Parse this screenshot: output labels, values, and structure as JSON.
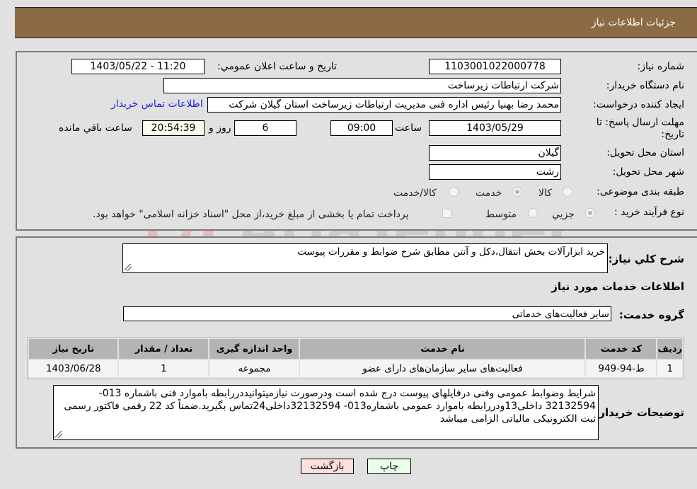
{
  "header": {
    "title": "جزئیات اطلاعات نیاز"
  },
  "form": {
    "need_number": {
      "label": "شماره نیاز:",
      "value": "1103001022000778"
    },
    "announce_datetime": {
      "label": "تاریخ و ساعت اعلان عمومي:",
      "value": "1403/05/22 - 11:20"
    },
    "buyer_org": {
      "label": "نام دستگاه خریدار:",
      "value": "شرکت ارتباطات زیرساخت"
    },
    "requester": {
      "label": "ایجاد کننده درخواست:",
      "value": "محمد رضا بهنیا رئیس اداره فنی مدیریت ارتباطات زیرساخت استان گیلان شرکت"
    },
    "buyer_contact_link": "اطلاعات تماس خریدار",
    "deadline": {
      "label": "مهلت ارسال پاسخ: تا تاریخ:",
      "date": "1403/05/29",
      "time_label": "ساعت",
      "time": "09:00",
      "days": "6",
      "days_label": "روز و",
      "remaining": "20:54:39",
      "remaining_label": "ساعت باقي مانده"
    },
    "province": {
      "label": "استان محل تحویل:",
      "value": "گیلان"
    },
    "city": {
      "label": "شهر محل تحویل:",
      "value": "رشت"
    },
    "category": {
      "label": "طبقه بندی موضوعی:",
      "options": [
        "کالا",
        "خدمت",
        "کالا/خدمت"
      ],
      "selected": "خدمت"
    },
    "purchase_type": {
      "label": "نوع فرآیند خرید :",
      "options": [
        "جزيي",
        "متوسط"
      ],
      "selected": "جزيي",
      "treasury_note": "پرداخت تمام یا بخشی از مبلغ خرید،از محل \"اسناد خزانه اسلامی\" خواهد بود."
    }
  },
  "details": {
    "summary_label": "شرح کلي نیاز:",
    "summary_value": "خرید ابزارآلات بخش انتقال،دکل و آنتن مطابق شرح ضوابط و مقررات پیوست",
    "services_heading": "اطلاعات خدمات مورد نیاز",
    "service_group_label": "گروه خدمت:",
    "service_group_value": "سایر فعالیت‌های خدماتی",
    "table": {
      "headers": [
        "ردیف",
        "کد خدمت",
        "نام خدمت",
        "واحد اندازه گیری",
        "تعداد / مقدار",
        "تاریخ نیاز"
      ],
      "rows": [
        [
          "1",
          "ط-94-949",
          "فعالیت‌های سایر سازمان‌های دارای عضو",
          "مجموعه",
          "1",
          "1403/06/28"
        ]
      ]
    },
    "buyer_notes_label": "توضیحات خریدار:",
    "buyer_notes_value": "شرایط وضوابط عمومی وفنی درفایلهای پیوست درج شده است ودرصورت نیازمیتوانیددررابطه باموارد فنی باشماره 013-32132594 داخلی13ودررابطه باموارد عمومی باشماره013- 32132594داخلی24تماس  بگیرید.ضمناً کد 22 رقمی فاکتور رسمی ثبت الکترونیکی مالیاتی الزامی میباشد"
  },
  "buttons": {
    "back": "بازگشت",
    "print": "چاپ"
  },
  "watermark": "AriaTender.neT"
}
